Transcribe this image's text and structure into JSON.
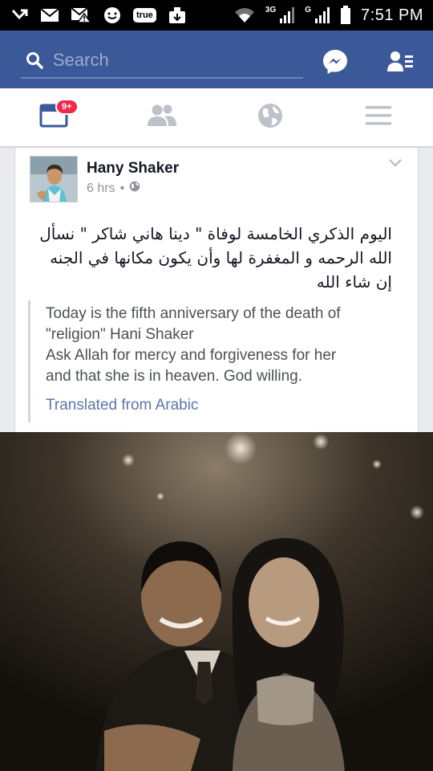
{
  "status_bar": {
    "time": "7:51 PM",
    "true_label": "true",
    "net_3g": "3G",
    "net_g": "G",
    "icons": [
      "missed-call-icon",
      "gmail-icon",
      "gmail-alert-icon",
      "messenger-chat-icon",
      "true-app-icon",
      "download-icon",
      "wifi-icon",
      "signal-3g-icon",
      "signal-g-icon",
      "battery-icon"
    ]
  },
  "header": {
    "search_placeholder": "Search",
    "colors": {
      "bar": "#3b5998",
      "placeholder": "#9aabd1"
    }
  },
  "tabs": {
    "items": [
      "news-feed-icon",
      "friend-requests-icon",
      "notifications-globe-icon",
      "menu-icon"
    ],
    "badge": "9+"
  },
  "post": {
    "author": "Hany Shaker",
    "time": "6 hrs",
    "separator": "•",
    "privacy_icon": "globe-icon",
    "arabic_text": "اليوم الذكري الخامسة لوفاة \" دينا هاني شاكر \" نسأل الله الرحمه و المغفرة لها  وأن يكون مكانها في الجنه  إن شاء الله",
    "translation_line1": "Today is the fifth anniversary of the death of",
    "translation_line2": "\"religion\" Hani Shaker",
    "translation_line3": "Ask Allah for mercy and forgiveness for her",
    "translation_line4": "and that she is in heaven. God willing.",
    "translated_label": "Translated from Arabic"
  }
}
